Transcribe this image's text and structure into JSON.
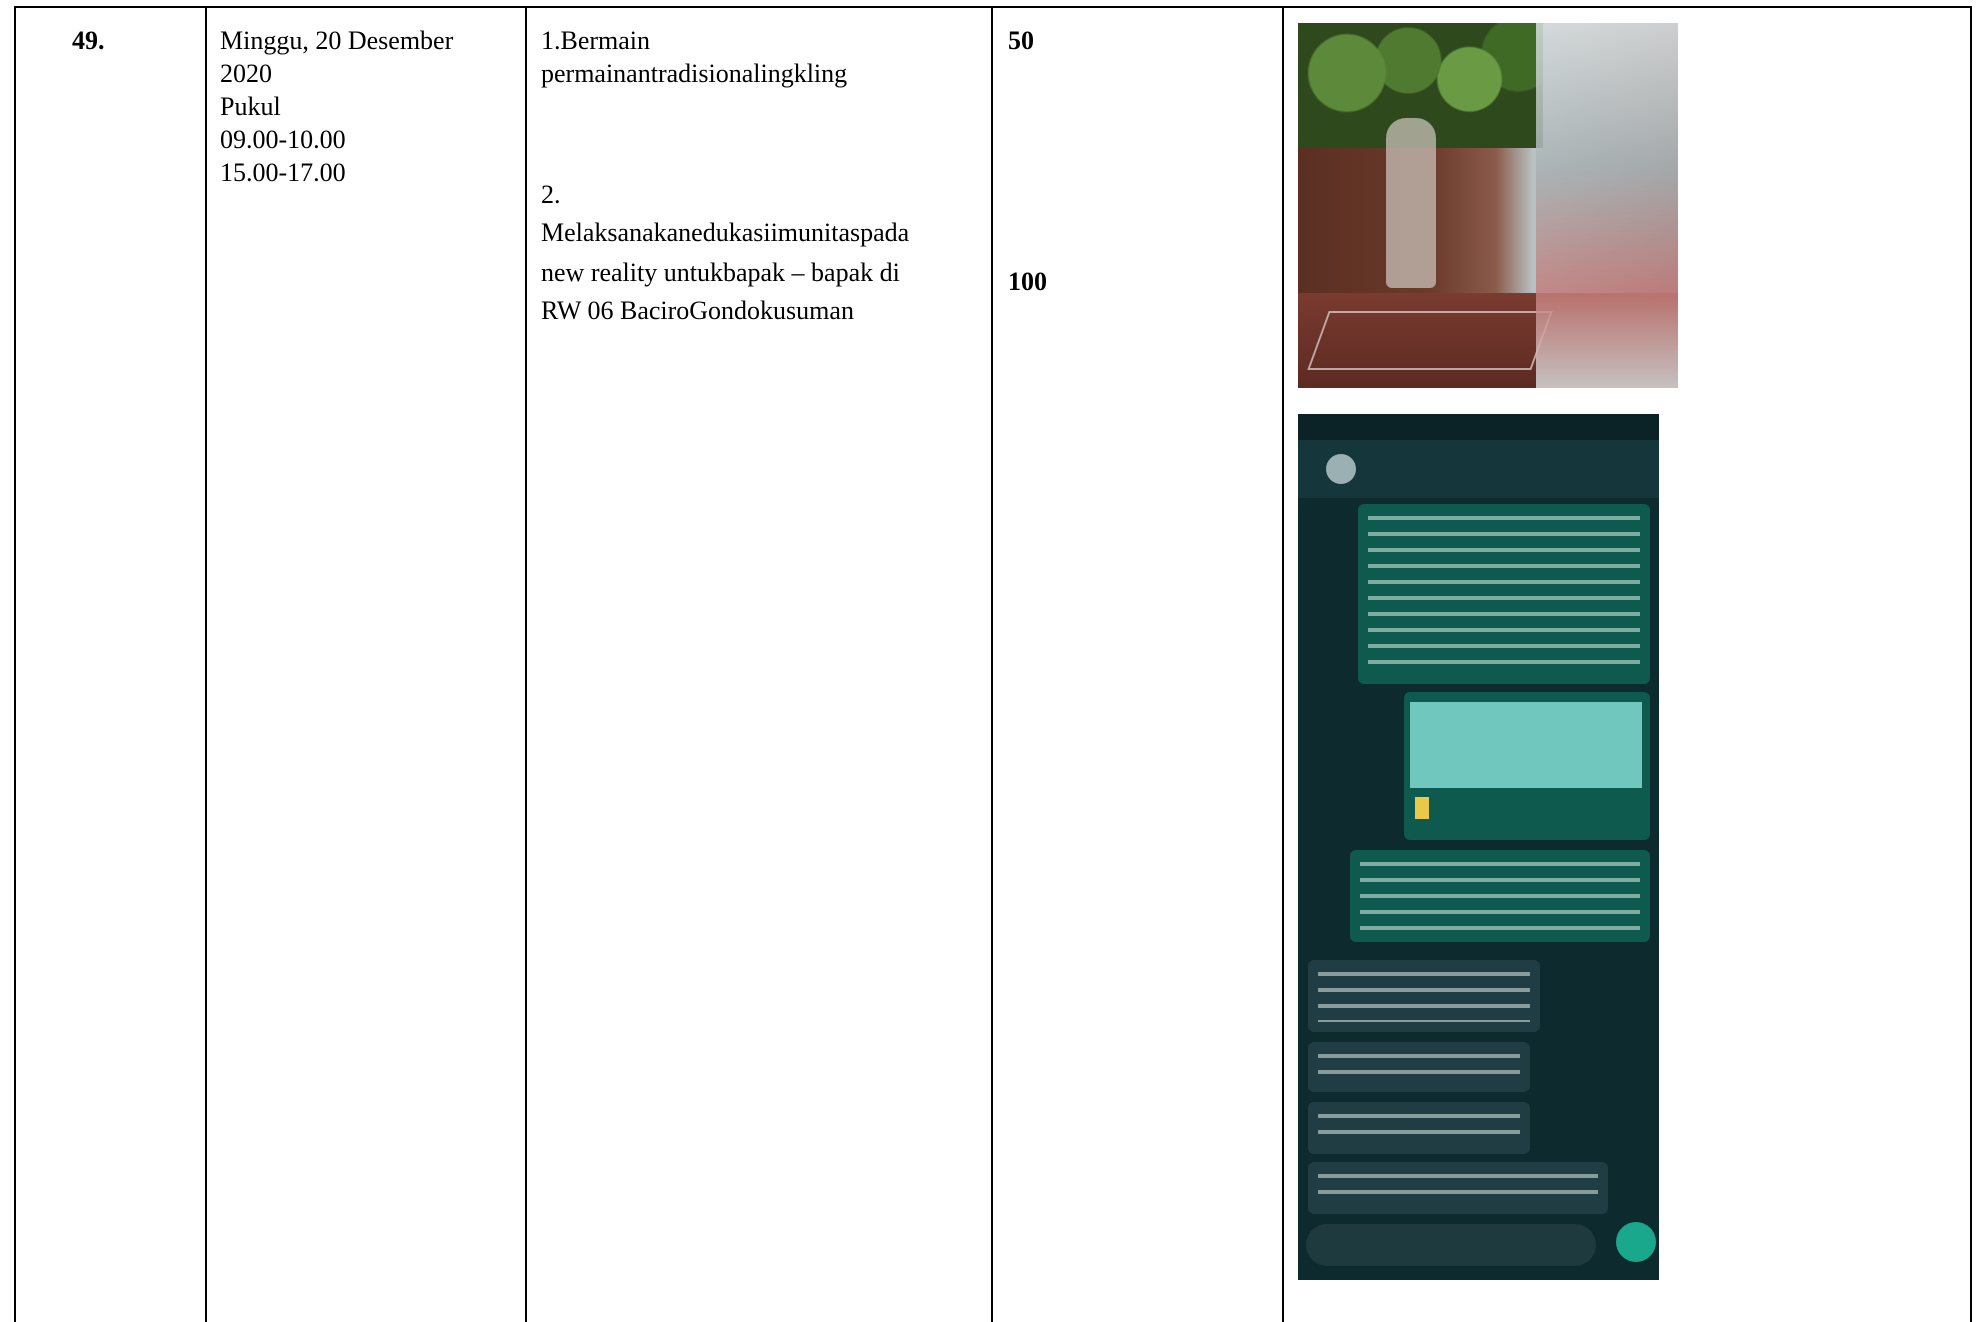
{
  "row": {
    "number": "49.",
    "date_lines": [
      "Minggu, 20 Desember",
      "2020",
      "Pukul",
      "09.00-10.00",
      "15.00-17.00"
    ],
    "activity_1_lines": [
      "1.Bermain",
      "permainantradisionalingkling"
    ],
    "activity_2_lines": [
      "2.",
      "Melaksanakanedukasiimunitaspada",
      "new reality untukbapak – bapak di",
      "RW 06 BaciroGondokusuman"
    ],
    "value_1": "50",
    "value_2": "100"
  }
}
